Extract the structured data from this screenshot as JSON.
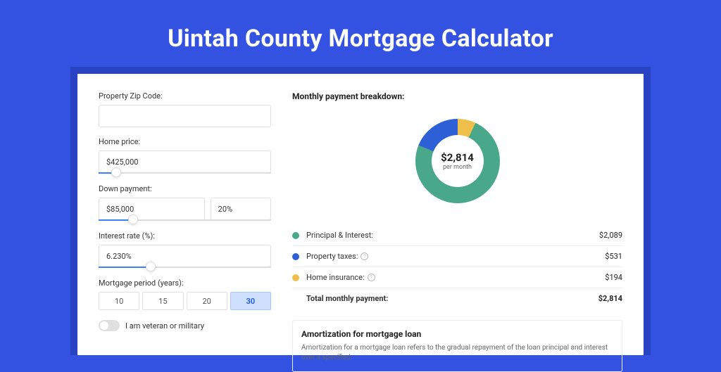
{
  "title": "Uintah County Mortgage Calculator",
  "inputs": {
    "zip": {
      "label": "Property Zip Code:",
      "value": ""
    },
    "home_price": {
      "label": "Home price:",
      "value": "$425,000",
      "slider_pct": 10
    },
    "down_payment": {
      "label": "Down payment:",
      "value": "$85,000",
      "percent": "20%",
      "slider_pct": 20
    },
    "interest_rate": {
      "label": "Interest rate (%):",
      "value": "6.230%",
      "slider_pct": 30
    },
    "period": {
      "label": "Mortgage period (years):",
      "options": [
        "10",
        "15",
        "20",
        "30"
      ],
      "selected": "30"
    },
    "veteran": {
      "label": "I am veteran or military",
      "on": false
    }
  },
  "breakdown": {
    "title": "Monthly payment breakdown:",
    "total_display": "$2,814",
    "per_month": "per month",
    "items": [
      {
        "label": "Principal & Interest:",
        "value": "$2,089",
        "color": "#49a78a"
      },
      {
        "label": "Property taxes:",
        "value": "$531",
        "color": "#2d5fd6"
      },
      {
        "label": "Home insurance:",
        "value": "$194",
        "color": "#eec04b"
      }
    ],
    "total_label": "Total monthly payment:"
  },
  "amortization": {
    "title": "Amortization for mortgage loan",
    "text": "Amortization for a mortgage loan refers to the gradual repayment of the loan principal and interest over a specified"
  },
  "chart_data": {
    "type": "pie",
    "title": "Monthly payment breakdown",
    "categories": [
      "Principal & Interest",
      "Property taxes",
      "Home insurance"
    ],
    "values": [
      2089,
      531,
      194
    ],
    "colors": [
      "#49a78a",
      "#2d5fd6",
      "#eec04b"
    ],
    "center_label": "$2,814 per month",
    "total": 2814
  }
}
